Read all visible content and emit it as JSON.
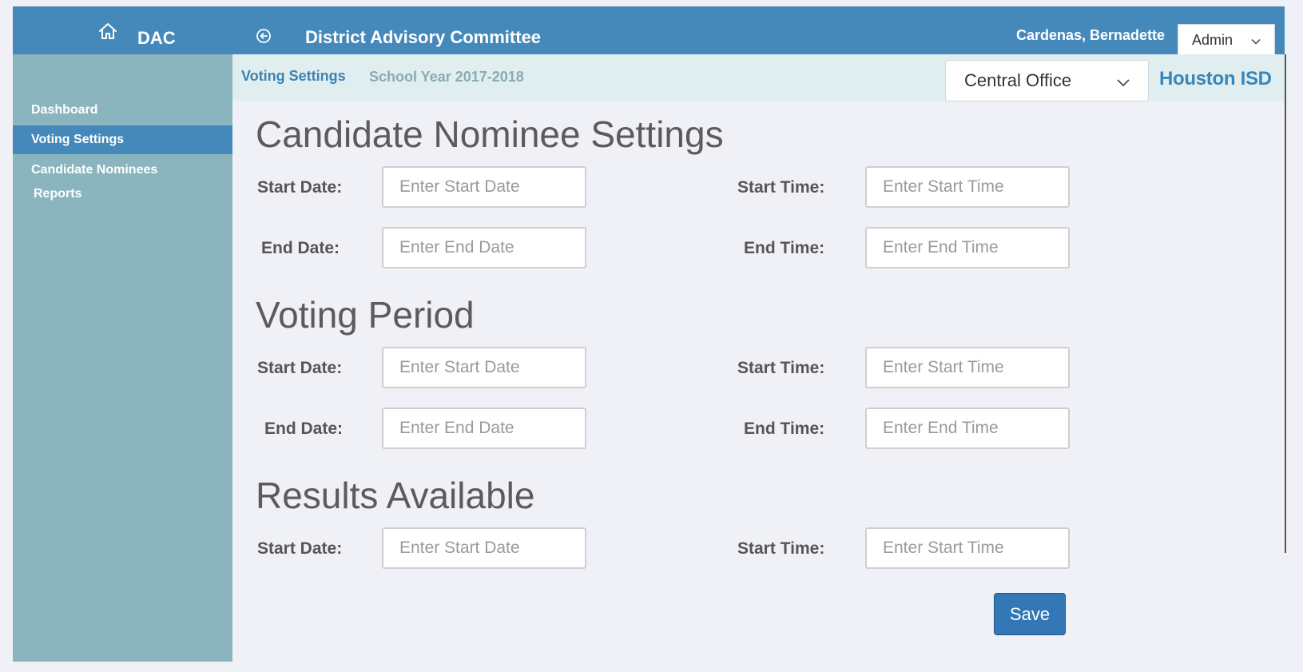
{
  "header": {
    "home_icon": "home-icon",
    "app_name": "DAC",
    "back_icon": "back-circle-icon",
    "title": "District Advisory Committee",
    "user_name": "Cardenas, Bernadette",
    "role": "Admin",
    "background_color": "#4589bb"
  },
  "sidebar": {
    "background_color": "#8ab5be",
    "items": [
      {
        "label": "Dashboard"
      },
      {
        "label": "Voting Settings",
        "active": true
      },
      {
        "label": "Candidate Nominees"
      },
      {
        "label": "Reports"
      }
    ]
  },
  "subheader": {
    "breadcrumb": "Voting Settings",
    "school_year_label": "School Year  2017-2018",
    "office": "Central Office",
    "brand": "Houston ISD"
  },
  "sections": [
    {
      "title": "Candidate Nominee Settings",
      "start_date_label": "Start Date:",
      "start_date_placeholder": "Enter Start Date",
      "start_time_label": "Start Time:",
      "start_time_placeholder": "Enter Start Time",
      "end_date_label": "End Date:",
      "end_date_placeholder": "Enter End Date",
      "end_time_label": "End Time:",
      "end_time_placeholder": "Enter End Time"
    },
    {
      "title": "Voting Period",
      "start_date_label": "Start Date:",
      "start_date_placeholder": "Enter Start Date",
      "start_time_label": "Start Time:",
      "start_time_placeholder": "Enter Start Time",
      "end_date_label": "End Date:",
      "end_date_placeholder": "Enter End Date",
      "end_time_label": "End Time:",
      "end_time_placeholder": "Enter End Time"
    },
    {
      "title": "Results Available",
      "start_date_label": "Start Date:",
      "start_date_placeholder": "Enter Start Date",
      "start_time_label": "Start Time:",
      "start_time_placeholder": "Enter Start Time"
    }
  ],
  "actions": {
    "save_label": "Save",
    "save_color": "#3377b6"
  }
}
